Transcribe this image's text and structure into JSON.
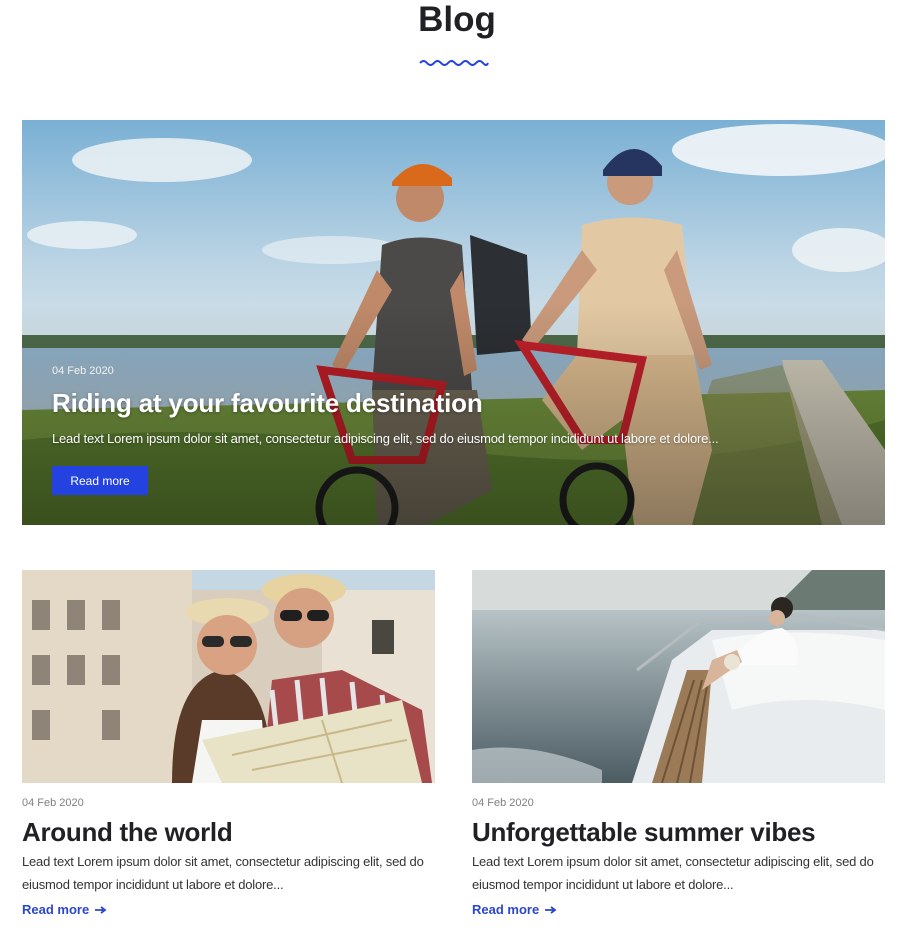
{
  "page": {
    "title": "Blog"
  },
  "colors": {
    "accent": "#2442e0",
    "link": "#2c47c9",
    "heading": "#1f2124"
  },
  "hero": {
    "date": "04 Feb 2020",
    "title": "Riding at your favourite destination",
    "lead": "Lead text Lorem ipsum dolor sit amet, consectetur adipiscing elit, sed do eiusmod tempor incididunt ut labore et dolore...",
    "button_label": "Read more"
  },
  "posts": [
    {
      "date": "04 Feb 2020",
      "title": "Around the world",
      "lead": "Lead text Lorem ipsum dolor sit amet, consectetur adipiscing elit, sed do eiusmod tempor incididunt ut labore et dolore...",
      "link_label": "Read more",
      "icon": "arrow-right-icon"
    },
    {
      "date": "04 Feb 2020",
      "title": "Unforgettable summer vibes",
      "lead": "Lead text Lorem ipsum dolor sit amet, consectetur adipiscing elit, sed do eiusmod tempor incididunt ut labore et dolore...",
      "link_label": "Read more",
      "icon": "arrow-right-icon"
    }
  ]
}
